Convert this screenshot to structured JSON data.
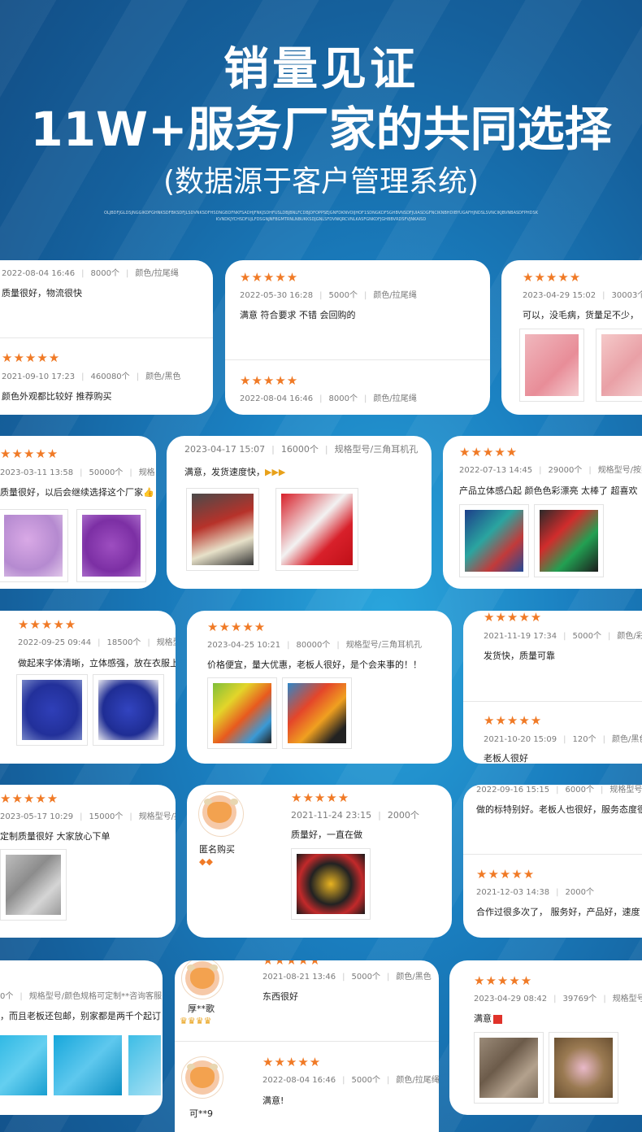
{
  "header": {
    "title": "销量见证",
    "subtitle": "11W+服务厂家的共同选择",
    "note": "(数据源于客户管理系统)",
    "tiny_line1": "OLJBDFJGLDSJNGGIKDFGHNKSDFBKSDFJLSDVNKSDFHSDNGBDFNKFSADHJFNKJSDHFUSLDBJBNLFCDBJDFOPPSEJGNFDKNVOIJHOF1SDNGKDFSGHBVNSDFJUIASDGFNCIKNBHDIBYUGAFHJNDSLSVNCIKJBVNBASDFPHDSK",
    "tiny_line2": "KVNDKJYCHSDFUJLFDSGNJNFBGMTRNLNBUKKSDJGNLSFDVNKJRCVNLKASFGNKDFJGHBBVRDSFVJNKAISD"
  },
  "icons": {
    "star": "star-icon",
    "thumbs": "thumbs-up-icon",
    "diamond": "diamond-icon",
    "avatar": "cow-avatar-icon"
  },
  "colors": {
    "star": "#f07a26",
    "accent": "#1a7fc0"
  },
  "cards": {
    "c1": {
      "a": {
        "date": "2022-08-04 16:46",
        "qty": "8000个",
        "spec": "颜色/拉尾绳",
        "text": "质量很好，物流很快"
      },
      "b": {
        "stars": "★★★★★",
        "date": "2021-09-10 17:23",
        "qty": "460080个",
        "spec": "颜色/黑色",
        "text": "颜色外观都比较好 推荐购买"
      }
    },
    "c2": {
      "a": {
        "stars": "★★★★★",
        "date": "2022-05-30 16:28",
        "qty": "5000个",
        "spec": "颜色/拉尾绳",
        "text": "满意 符合要求 不错 会回购的"
      },
      "b": {
        "stars": "★★★★★",
        "date": "2022-08-04 16:46",
        "qty": "8000个",
        "spec": "颜色/拉尾绳"
      }
    },
    "c3": {
      "stars": "★★★★★",
      "date": "2023-04-29 15:02",
      "qty": "30003个",
      "text": "可以，没毛病，货量足不少，"
    },
    "c4": {
      "stars": "★★★★★",
      "date": "2023-03-11 13:58",
      "qty": "50000个",
      "spec": "规格",
      "text": "质量很好，以后会继续选择这个厂家"
    },
    "c5": {
      "date": "2023-04-17 15:07",
      "qty": "16000个",
      "spec": "规格型号/三角耳机孔",
      "text": "满意，发货速度快，"
    },
    "c6": {
      "stars": "★★★★★",
      "date": "2022-07-13 14:45",
      "qty": "29000个",
      "spec": "规格型号/按要",
      "text": "产品立体感凸起 颜色色彩漂亮 太棒了 超喜欢"
    },
    "c7": {
      "stars": "★★★★★",
      "date": "2022-09-25 09:44",
      "qty": "18500个",
      "spec": "规格型",
      "text": "做起来字体清晰，立体感强，放在衣服上"
    },
    "c8": {
      "stars": "★★★★★",
      "date": "2023-04-25 10:21",
      "qty": "80000个",
      "spec": "规格型号/三角耳机孔",
      "text": "价格便宜，量大优惠，老板人很好，是个会来事的！！"
    },
    "c9": {
      "a": {
        "stars": "★★★★★",
        "date": "2021-11-19 17:34",
        "qty": "5000个",
        "spec": "颜色/彩色",
        "text": "发货快，质量可靠"
      },
      "b": {
        "stars": "★★★★★",
        "date": "2021-10-20 15:09",
        "qty": "120个",
        "spec": "颜色/黑色",
        "text": "老板人很好"
      }
    },
    "c10": {
      "stars": "★★★★★",
      "date": "2023-05-17 10:29",
      "qty": "15000个",
      "spec": "规格型号/按要",
      "text": "定制质量很好 大家放心下单"
    },
    "c11": {
      "user": "匿名购买",
      "stars": "★★★★★",
      "date": "2021-11-24 23:15",
      "qty": "2000个",
      "text": "质量好，一直在做"
    },
    "c12": {
      "a": {
        "date": "2022-09-16 15:15",
        "qty": "6000个",
        "spec": "规格型号/注",
        "text": "做的标特别好。老板人也很好，服务态度很"
      },
      "b": {
        "stars": "★★★★★",
        "date": "2021-12-03 14:38",
        "qty": "2000个",
        "text": "合作过很多次了， 服务好，产品好，速度"
      }
    },
    "c13": {
      "qty": "0个",
      "spec": "规格型号/颜色规格可定制**咨询客服",
      "text": "，而且老板还包邮，别家都是两千个起订"
    },
    "c14": {
      "a": {
        "user": "厚**歌",
        "stars": "★★★★★",
        "date": "2021-08-21 13:46",
        "qty": "5000个",
        "spec": "颜色/黑色",
        "text": "东西很好"
      },
      "b": {
        "user": "可**9",
        "stars": "★★★★★",
        "date": "2022-08-04 16:46",
        "qty": "5000个",
        "spec": "颜色/拉尾绳",
        "text": "满意!"
      }
    },
    "c15": {
      "stars": "★★★★★",
      "date": "2023-04-29 08:42",
      "qty": "39769个",
      "spec": "规格型号/",
      "text": "满意"
    }
  }
}
